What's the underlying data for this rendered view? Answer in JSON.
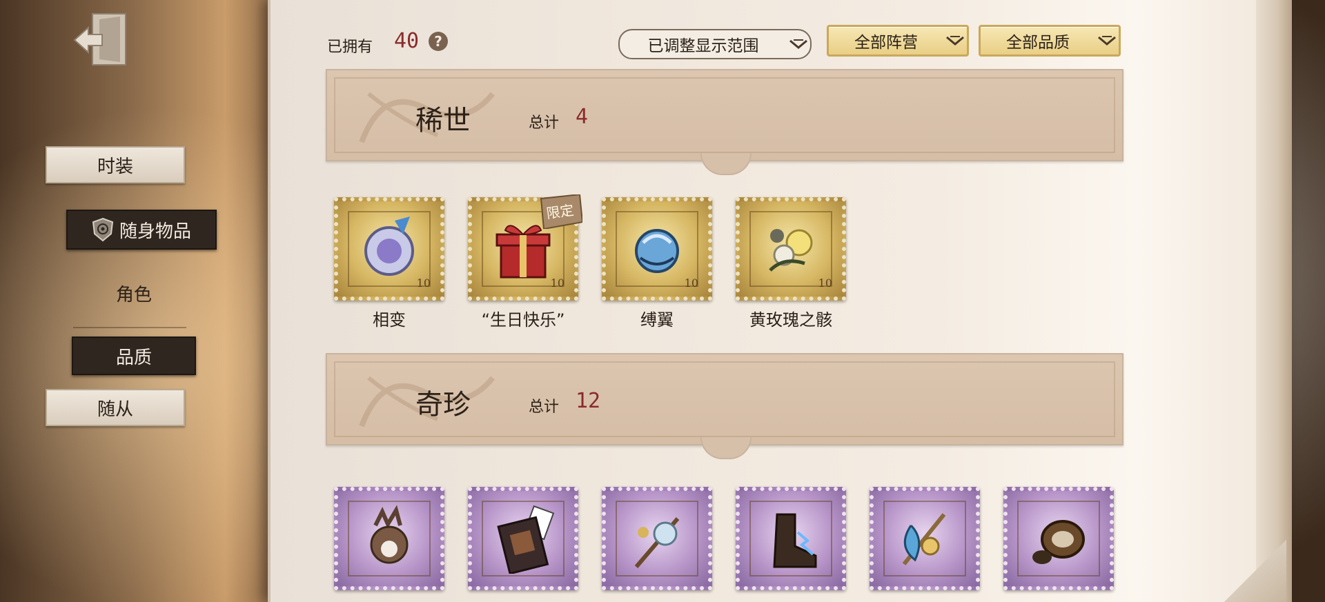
{
  "sidebar": {
    "items": [
      {
        "label": "时装"
      },
      {
        "label": "随身物品"
      },
      {
        "label": "角色"
      },
      {
        "label": "品质"
      },
      {
        "label": "随从"
      }
    ]
  },
  "header": {
    "owned_label": "已拥有",
    "owned_count": "40",
    "help_symbol": "?",
    "range_dropdown": "已调整显示范围",
    "camp_dropdown": "全部阵营",
    "quality_dropdown": "全部品质"
  },
  "sections": [
    {
      "title": "稀世",
      "total_label": "总计",
      "total": "4",
      "stamp_color": "gold",
      "items": [
        {
          "name": "相变",
          "icon": "phase-change-crystal"
        },
        {
          "name": "“生日快乐”",
          "icon": "gift-box",
          "tag": "限定"
        },
        {
          "name": "缚翼",
          "icon": "bound-wing-orb"
        },
        {
          "name": "黄玫瑰之骸",
          "icon": "yellow-rose"
        }
      ]
    },
    {
      "title": "奇珍",
      "total_label": "总计",
      "total": "12",
      "stamp_color": "purple",
      "items": [
        {
          "icon": "antler-charm"
        },
        {
          "icon": "card-case"
        },
        {
          "icon": "wand-orb"
        },
        {
          "icon": "lightning-boot"
        },
        {
          "icon": "crystal-hammer"
        },
        {
          "icon": "studded-ring"
        }
      ]
    }
  ],
  "stamp_denomination": "10",
  "colors": {
    "accent_red": "#8a2b2b",
    "gold_stamp": "#d6b763",
    "purple_stamp": "#b896c9",
    "dark_button": "#2f2620"
  }
}
